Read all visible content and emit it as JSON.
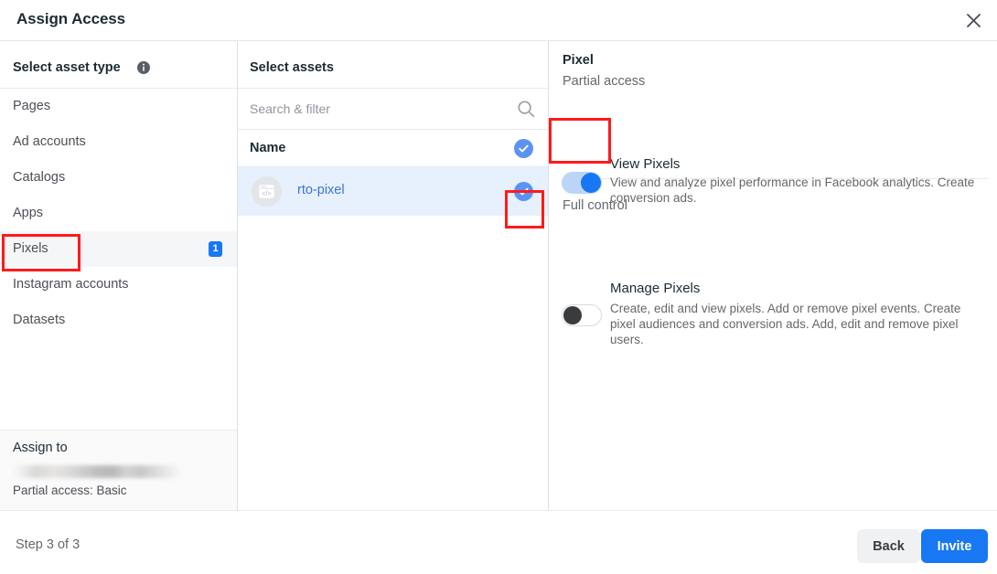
{
  "header": {
    "title": "Assign Access",
    "close_icon": "close-icon"
  },
  "column_asset_type": {
    "heading": "Select asset type",
    "info_icon": "info-icon",
    "items": [
      {
        "label": "Pages",
        "badge": "",
        "selected": false
      },
      {
        "label": "Ad accounts",
        "badge": "",
        "selected": false
      },
      {
        "label": "Catalogs",
        "badge": "",
        "selected": false
      },
      {
        "label": "Apps",
        "badge": "",
        "selected": false
      },
      {
        "label": "Pixels",
        "badge": "1",
        "selected": true
      },
      {
        "label": "Instagram accounts",
        "badge": "",
        "selected": false
      },
      {
        "label": "Datasets",
        "badge": "",
        "selected": false
      }
    ],
    "assign_to": {
      "title": "Assign to",
      "user_name": "",
      "access_summary": "Partial access: Basic"
    }
  },
  "column_assets": {
    "heading": "Select assets",
    "search_placeholder": "Search & filter",
    "search_value": "",
    "search_icon": "search-icon",
    "table_header": "Name",
    "header_checkbox_checked": true,
    "rows": [
      {
        "name": "rto-pixel",
        "icon": "pixel-code-icon",
        "checked": true,
        "selected": true
      }
    ]
  },
  "column_permissions": {
    "title": "Pixel",
    "partial_access_label": "Partial access",
    "full_control_label": "Full control",
    "permissions": [
      {
        "name": "View Pixels",
        "description": "View and analyze pixel performance in Facebook analytics. Create conversion ads.",
        "enabled": true
      },
      {
        "name": "Manage Pixels",
        "description": "Create, edit and view pixels. Add or remove pixel events. Create pixel audiences and conversion ads. Add, edit and remove pixel users.",
        "enabled": false
      }
    ]
  },
  "footer": {
    "step_label": "Step 3 of 3",
    "back_label": "Back",
    "invite_label": "Invite"
  },
  "colors": {
    "accent_blue": "#1877f2",
    "check_blue": "#5b93f2",
    "selected_row_bg": "#e7f0fd",
    "annotation_red": "#ff1a1a",
    "link_blue": "#3b76d4"
  }
}
